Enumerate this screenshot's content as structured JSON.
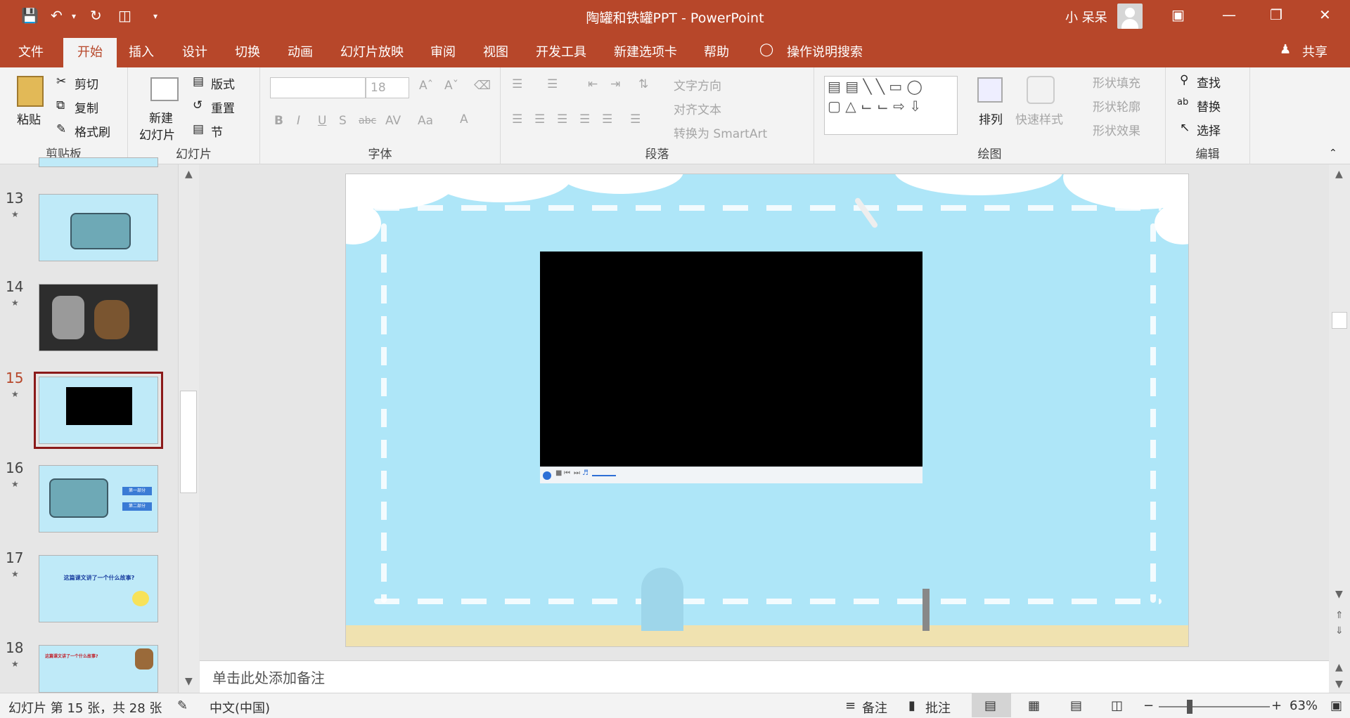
{
  "window": {
    "title": "陶罐和铁罐PPT - PowerPoint",
    "user": "小 呆呆",
    "share": "共享"
  },
  "tabs": [
    "文件",
    "开始",
    "插入",
    "设计",
    "切换",
    "动画",
    "幻灯片放映",
    "审阅",
    "视图",
    "开发工具",
    "新建选项卡",
    "帮助",
    "操作说明搜索"
  ],
  "ribbon": {
    "clipboard": {
      "group": "剪贴板",
      "paste": "粘贴",
      "cut": "剪切",
      "copy": "复制",
      "format_painter": "格式刷"
    },
    "slides": {
      "group": "幻灯片",
      "new_slide": "新建",
      "new_slide2": "幻灯片",
      "layout": "版式",
      "reset": "重置",
      "section": "节"
    },
    "font": {
      "group": "字体",
      "size": "18"
    },
    "paragraph": {
      "group": "段落",
      "text_direction": "文字方向",
      "align_text": "对齐文本",
      "smartart": "转换为 SmartArt"
    },
    "drawing": {
      "group": "绘图",
      "arrange": "排列",
      "quick_styles": "快速样式",
      "shape_fill": "形状填充",
      "shape_outline": "形状轮廓",
      "shape_effects": "形状效果"
    },
    "editing": {
      "group": "编辑",
      "find": "查找",
      "replace": "替换",
      "select": "选择"
    }
  },
  "thumbnails": [
    {
      "num": "13"
    },
    {
      "num": "14"
    },
    {
      "num": "15"
    },
    {
      "num": "16",
      "btn1": "第一部分",
      "btn2": "第二部分"
    },
    {
      "num": "17",
      "text": "这篇课文讲了一个什么故事?"
    },
    {
      "num": "18",
      "text": "这篇课文讲了一个什么故事?"
    }
  ],
  "notes_placeholder": "单击此处添加备注",
  "status": {
    "slide_info": "幻灯片 第 15 张，共 28 张",
    "language": "中文(中国)",
    "notes": "备注",
    "comments": "批注",
    "zoom": "63%"
  }
}
